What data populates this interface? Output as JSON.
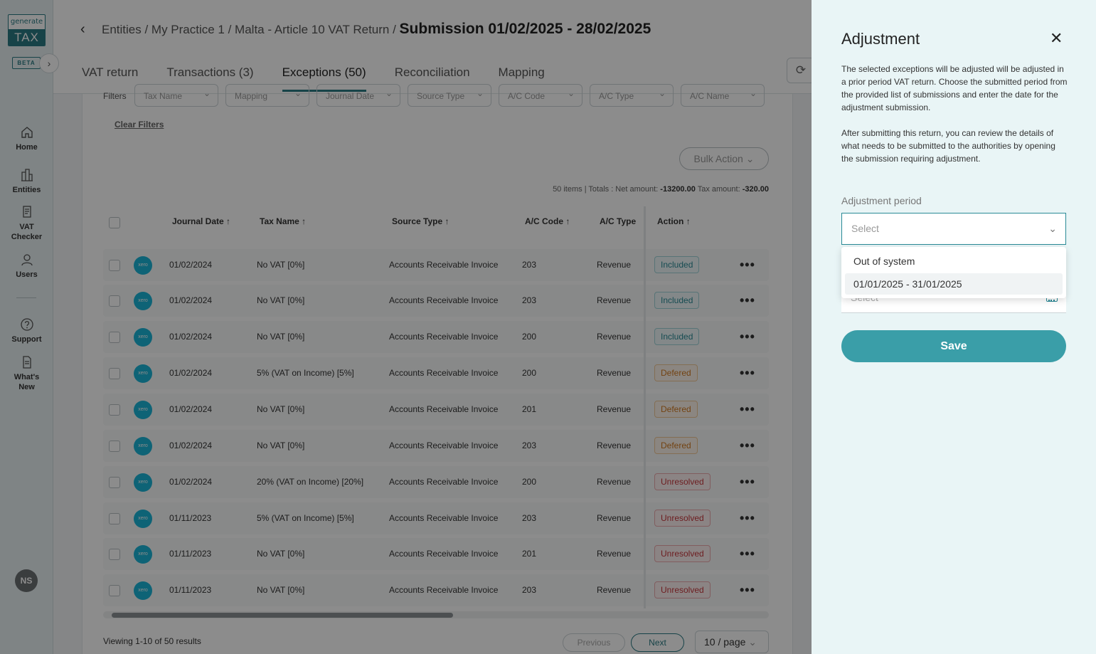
{
  "sidebar": {
    "logo_top": "generate",
    "logo_bottom": "TAX",
    "beta": "BETA",
    "items": [
      {
        "label": "Home"
      },
      {
        "label": "Entities"
      },
      {
        "label": "VAT Checker"
      },
      {
        "label": "Users"
      },
      {
        "label": "Support"
      },
      {
        "label": "What's New"
      }
    ],
    "avatar": "NS"
  },
  "header": {
    "breadcrumb": "Entities / My Practice 1 / Malta - Article 10 VAT Return /",
    "title": "Submission 01/02/2025 - 28/02/2025",
    "tabs": [
      {
        "label": "VAT return"
      },
      {
        "label": "Transactions (3)"
      },
      {
        "label": "Exceptions (50)"
      },
      {
        "label": "Reconciliation"
      },
      {
        "label": "Mapping"
      }
    ]
  },
  "filters": {
    "label": "Filters",
    "items": [
      "Tax Name",
      "Mapping",
      "Journal Date",
      "Source Type",
      "A/C Code",
      "A/C Type",
      "A/C Name"
    ],
    "clear": "Clear Filters"
  },
  "table": {
    "bulk_action": "Bulk Action",
    "totals_prefix": "50 items | Totals : Net amount:",
    "net_amount": "-13200.00",
    "tax_label": "Tax amount:",
    "tax_amount": "-320.00",
    "headers": [
      "Journal Date",
      "Tax Name",
      "Source Type",
      "A/C Code",
      "A/C Type",
      "Action"
    ],
    "source_icon": "xero",
    "rows": [
      {
        "date": "01/02/2024",
        "tax": "No VAT [0%]",
        "source": "Accounts Receivable Invoice",
        "code": "203",
        "type": "Revenue",
        "status": "Included"
      },
      {
        "date": "01/02/2024",
        "tax": "No VAT [0%]",
        "source": "Accounts Receivable Invoice",
        "code": "203",
        "type": "Revenue",
        "status": "Included"
      },
      {
        "date": "01/02/2024",
        "tax": "No VAT [0%]",
        "source": "Accounts Receivable Invoice",
        "code": "200",
        "type": "Revenue",
        "status": "Included"
      },
      {
        "date": "01/02/2024",
        "tax": "5% (VAT on Income) [5%]",
        "source": "Accounts Receivable Invoice",
        "code": "200",
        "type": "Revenue",
        "status": "Defered"
      },
      {
        "date": "01/02/2024",
        "tax": "No VAT [0%]",
        "source": "Accounts Receivable Invoice",
        "code": "201",
        "type": "Revenue",
        "status": "Defered"
      },
      {
        "date": "01/02/2024",
        "tax": "No VAT [0%]",
        "source": "Accounts Receivable Invoice",
        "code": "203",
        "type": "Revenue",
        "status": "Defered"
      },
      {
        "date": "01/02/2024",
        "tax": "20% (VAT on Income) [20%]",
        "source": "Accounts Receivable Invoice",
        "code": "200",
        "type": "Revenue",
        "status": "Unresolved"
      },
      {
        "date": "01/11/2023",
        "tax": "5% (VAT on Income) [5%]",
        "source": "Accounts Receivable Invoice",
        "code": "203",
        "type": "Revenue",
        "status": "Unresolved"
      },
      {
        "date": "01/11/2023",
        "tax": "No VAT [0%]",
        "source": "Accounts Receivable Invoice",
        "code": "201",
        "type": "Revenue",
        "status": "Unresolved"
      },
      {
        "date": "01/11/2023",
        "tax": "No VAT [0%]",
        "source": "Accounts Receivable Invoice",
        "code": "203",
        "type": "Revenue",
        "status": "Unresolved"
      }
    ],
    "more_glyph": "•••"
  },
  "pagination": {
    "viewing": "Viewing 1-10 of 50 results",
    "previous": "Previous",
    "next": "Next",
    "page_size": "10 / page"
  },
  "drawer": {
    "title": "Adjustment",
    "close_glyph": "✕",
    "para1": "The selected exceptions will be adjusted will be adjusted in a prior period VAT return. Choose the submitted period from the provided list of submissions and enter the date for the adjustment submission.",
    "para2": "After submitting this return, you can review the details of what needs to be submitted to the authorities by opening the submission requiring adjustment.",
    "period_label": "Adjustment period",
    "period_placeholder": "Select",
    "date_placeholder": "Select",
    "options": [
      "Out of system",
      "01/01/2025 - 31/01/2025"
    ],
    "save": "Save"
  },
  "colors": {
    "accent": "#2a7a83",
    "save_button": "#3a9ea8",
    "drawer_bg": "#e9f5f6",
    "included": "#2a8a96",
    "defered": "#d17a22",
    "unresolved": "#c7383d"
  }
}
